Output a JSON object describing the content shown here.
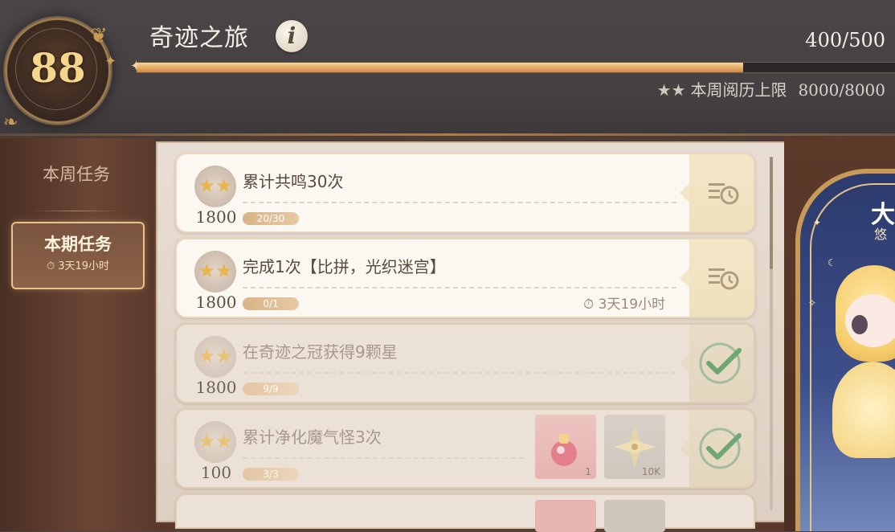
{
  "header": {
    "level": "88",
    "title": "奇迹之旅",
    "info_glyph": "i",
    "xp_text": "400/500",
    "xp_progress": 0.8,
    "weekly_cap_label": "本周阅历上限",
    "weekly_cap_value": "8000/8000"
  },
  "sidebar": {
    "tabs": [
      {
        "label": "本周任务"
      },
      {
        "label": "本期任务",
        "timer": "3天19小时",
        "selected": true
      }
    ]
  },
  "tasks": [
    {
      "name": "累计共鸣30次",
      "reward": "1800",
      "progress": "20/30",
      "status": "in-progress"
    },
    {
      "name": "完成1次【比拼，光织迷宫】",
      "reward": "1800",
      "progress": "0/1",
      "timer": "3天19小时",
      "status": "in-progress"
    },
    {
      "name": "在奇迹之冠获得9颗星",
      "reward": "1800",
      "progress": "9/9",
      "status": "completed"
    },
    {
      "name": "累计净化魔气怪3次",
      "reward": "100",
      "progress": "3/3",
      "status": "completed",
      "items": [
        {
          "qty": "1",
          "icon": "potion-icon"
        },
        {
          "qty": "10K",
          "icon": "flower-icon"
        }
      ]
    }
  ],
  "banner": {
    "title": "大",
    "subtitle": "悠"
  },
  "colors": {
    "accent_gold": "#e4a662",
    "level_text": "#f6d58c",
    "check_green": "#7fae84"
  }
}
